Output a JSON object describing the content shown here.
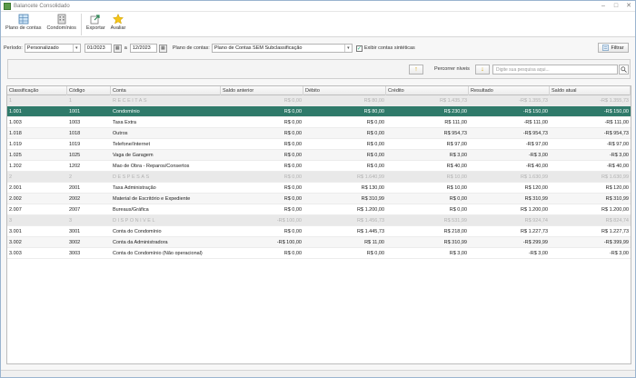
{
  "window": {
    "title": "Balancete Consolidado"
  },
  "ribbon": {
    "plano_label": "Plano de contas",
    "condominios_label": "Condomínios",
    "exportar_label": "Exportar",
    "avaliar_label": "Avaliar"
  },
  "filters": {
    "periodo_label": "Período:",
    "periodo_value": "Personalizado",
    "date_from": "01/2023",
    "date_sep": "a",
    "date_to": "12/2023",
    "plano_label": "Plano de contas:",
    "plano_value": "Plano de Contas SEM Subclassificação",
    "sinteticas_label": "Exibir contas sintéticas",
    "filtrar_label": "Filtrar"
  },
  "nav": {
    "percorrer_label": "Percorrer níveis",
    "search_placeholder": "Digite sua pesquisa aqui..."
  },
  "table": {
    "headers": [
      "Classificação",
      "Código",
      "Conta",
      "Saldo anterior",
      "Débito",
      "Crédito",
      "Resultado",
      "Saldo atual"
    ],
    "rows": [
      {
        "cls": "1",
        "cod": "1",
        "conta": "RECEITAS",
        "ant": "R$ 0,00",
        "deb": "R$ 80,00",
        "cred": "R$ 1.435,73",
        "res": "-R$ 1.355,73",
        "atual": "-R$ 1.355,73",
        "type": "group"
      },
      {
        "cls": "1.001",
        "cod": "1001",
        "conta": "Condomínio",
        "ant": "R$ 0,00",
        "deb": "R$ 80,00",
        "cred": "R$ 230,00",
        "res": "-R$ 150,00",
        "atual": "-R$ 150,00",
        "type": "selected"
      },
      {
        "cls": "1.003",
        "cod": "1003",
        "conta": "Taxa Extra",
        "ant": "R$ 0,00",
        "deb": "R$ 0,00",
        "cred": "R$ 111,00",
        "res": "-R$ 111,00",
        "atual": "-R$ 111,00",
        "type": "normal"
      },
      {
        "cls": "1.018",
        "cod": "1018",
        "conta": "Outros",
        "ant": "R$ 0,00",
        "deb": "R$ 0,00",
        "cred": "R$ 954,73",
        "res": "-R$ 954,73",
        "atual": "-R$ 954,73",
        "type": "alt"
      },
      {
        "cls": "1.019",
        "cod": "1019",
        "conta": "Telefone/Internet",
        "ant": "R$ 0,00",
        "deb": "R$ 0,00",
        "cred": "R$ 97,00",
        "res": "-R$ 97,00",
        "atual": "-R$ 97,00",
        "type": "normal"
      },
      {
        "cls": "1.025",
        "cod": "1025",
        "conta": "Vaga de Garagem",
        "ant": "R$ 0,00",
        "deb": "R$ 0,00",
        "cred": "R$ 3,00",
        "res": "-R$ 3,00",
        "atual": "-R$ 3,00",
        "type": "alt"
      },
      {
        "cls": "1.202",
        "cod": "1202",
        "conta": "Mao de Obra - Reparos/Consertos",
        "ant": "R$ 0,00",
        "deb": "R$ 0,00",
        "cred": "R$ 40,00",
        "res": "-R$ 40,00",
        "atual": "-R$ 40,00",
        "type": "normal"
      },
      {
        "cls": "2",
        "cod": "2",
        "conta": "DESPESAS",
        "ant": "R$ 0,00",
        "deb": "R$ 1.640,99",
        "cred": "R$ 10,00",
        "res": "R$ 1.630,99",
        "atual": "R$ 1.630,99",
        "type": "group"
      },
      {
        "cls": "2.001",
        "cod": "2001",
        "conta": "Taxa Administração",
        "ant": "R$ 0,00",
        "deb": "R$ 130,00",
        "cred": "R$ 10,00",
        "res": "R$ 120,00",
        "atual": "R$ 120,00",
        "type": "normal"
      },
      {
        "cls": "2.002",
        "cod": "2002",
        "conta": "Material de Escritório e Expediente",
        "ant": "R$ 0,00",
        "deb": "R$ 310,99",
        "cred": "R$ 0,00",
        "res": "R$ 310,99",
        "atual": "R$ 310,99",
        "type": "alt"
      },
      {
        "cls": "2.007",
        "cod": "2007",
        "conta": "Bureaus/Gráfica",
        "ant": "R$ 0,00",
        "deb": "R$ 1.200,00",
        "cred": "R$ 0,00",
        "res": "R$ 1.200,00",
        "atual": "R$ 1.200,00",
        "type": "normal"
      },
      {
        "cls": "3",
        "cod": "3",
        "conta": "DISPONÍVEL",
        "ant": "-R$ 100,00",
        "deb": "R$ 1.456,73",
        "cred": "R$ 531,99",
        "res": "R$ 924,74",
        "atual": "R$ 824,74",
        "type": "group"
      },
      {
        "cls": "3.001",
        "cod": "3001",
        "conta": "Conta do Condomínio",
        "ant": "R$ 0,00",
        "deb": "R$ 1.445,73",
        "cred": "R$ 218,00",
        "res": "R$ 1.227,73",
        "atual": "R$ 1.227,73",
        "type": "normal"
      },
      {
        "cls": "3.002",
        "cod": "3002",
        "conta": "Conta da Administradora",
        "ant": "-R$ 100,00",
        "deb": "R$ 11,00",
        "cred": "R$ 310,99",
        "res": "-R$ 299,99",
        "atual": "-R$ 399,99",
        "type": "alt"
      },
      {
        "cls": "3.003",
        "cod": "3003",
        "conta": "Conta do Condomínio (Não operacional)",
        "ant": "R$ 0,00",
        "deb": "R$ 0,00",
        "cred": "R$ 3,00",
        "res": "-R$ 3,00",
        "atual": "-R$ 3,00",
        "type": "normal"
      }
    ]
  }
}
